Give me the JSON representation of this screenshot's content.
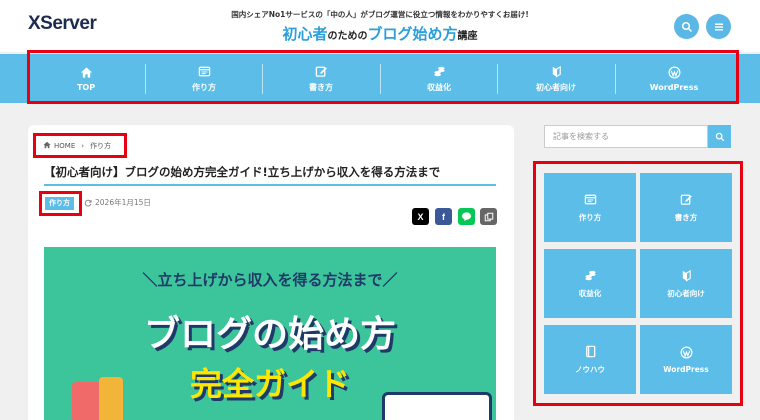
{
  "header": {
    "logo": "XServer",
    "tagline": "国内シェアNo1サービスの「中の人」がブログ運営に役立つ情報をわかりやすくお届け!",
    "title_part1": "初心者",
    "title_part2": "のための",
    "title_part3": "ブログ始め方",
    "title_part4": "講座"
  },
  "nav": {
    "items": [
      {
        "label": "TOP",
        "icon": "home-icon"
      },
      {
        "label": "作り方",
        "icon": "browser-icon"
      },
      {
        "label": "書き方",
        "icon": "edit-icon"
      },
      {
        "label": "収益化",
        "icon": "coins-icon"
      },
      {
        "label": "初心者向け",
        "icon": "beginner-mark-icon"
      },
      {
        "label": "WordPress",
        "icon": "wordpress-icon"
      }
    ]
  },
  "breadcrumb": {
    "home": "HOME",
    "category": "作り方"
  },
  "article": {
    "title": "【初心者向け】ブログの始め方完全ガイド!立ち上げから収入を得る方法まで",
    "category": "作り方",
    "date": "2026年1月15日"
  },
  "banner": {
    "sub": "＼立ち上げから収入を得る方法まで／",
    "main": "ブログの始め方",
    "sub2": "完全ガイド"
  },
  "sidebar": {
    "search_placeholder": "記事を検索する",
    "tiles": [
      {
        "label": "作り方",
        "icon": "browser-icon"
      },
      {
        "label": "書き方",
        "icon": "edit-icon"
      },
      {
        "label": "収益化",
        "icon": "coins-icon"
      },
      {
        "label": "初心者向け",
        "icon": "beginner-mark-icon"
      },
      {
        "label": "ノウハウ",
        "icon": "book-icon"
      },
      {
        "label": "WordPress",
        "icon": "wordpress-icon"
      }
    ]
  },
  "colors": {
    "accent": "#5bbde8",
    "highlight": "#e60012",
    "banner_bg": "#3cc49b"
  }
}
